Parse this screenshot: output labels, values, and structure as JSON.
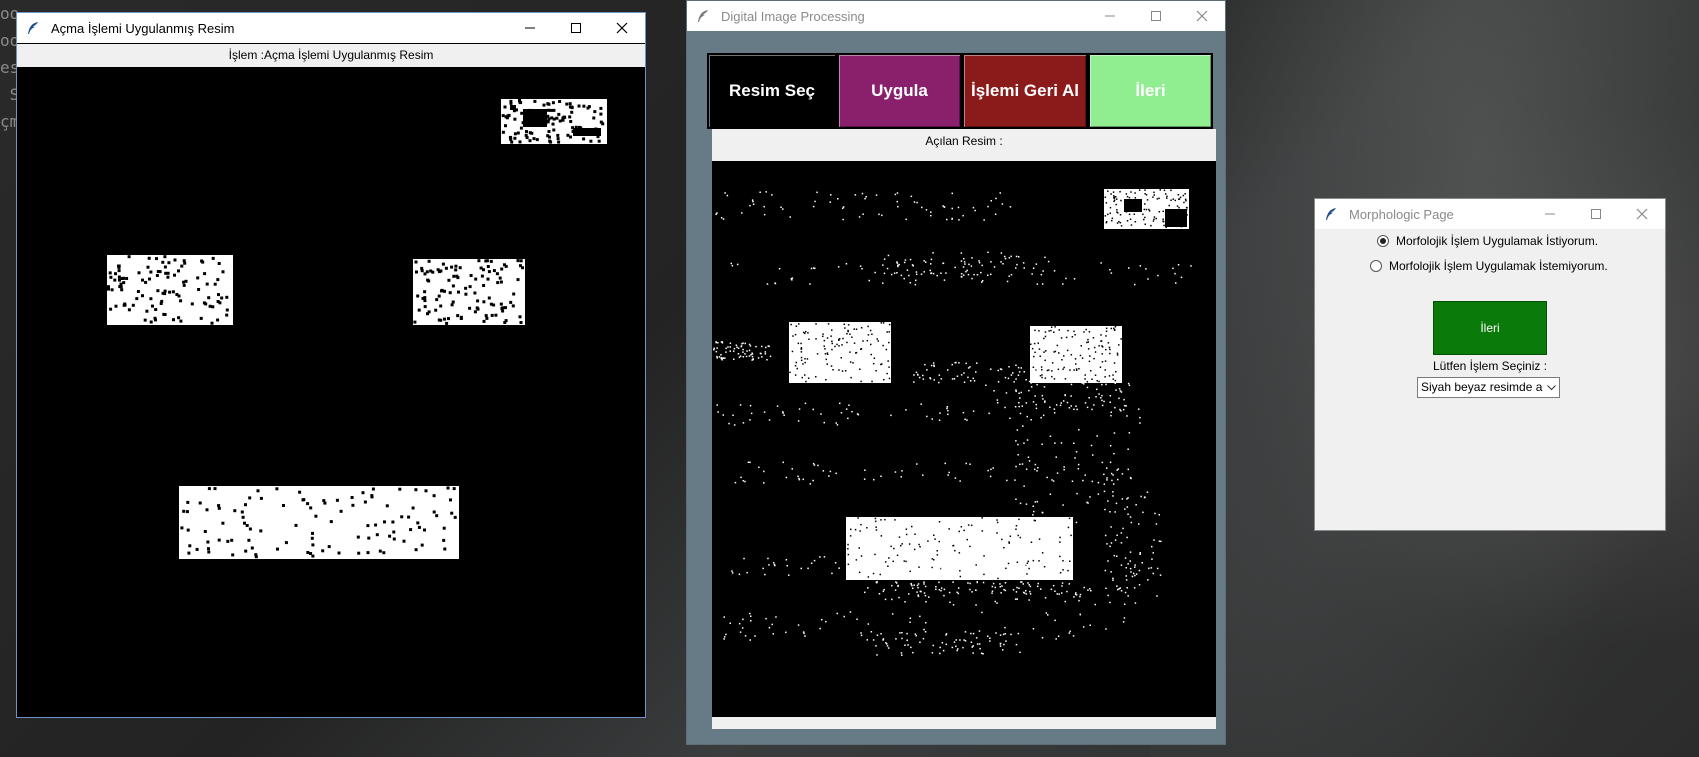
{
  "desktop": {
    "code_lines": [
      "oo :. Resim Yüklendi.",
      "oo",
      "es",
      " S",
      "çm"
    ]
  },
  "window_opened": {
    "title": "Açma İşlemi Uygulanmış Resim",
    "header_label": "İşlem :Açma İşlemi Uygulanmış Resim",
    "controls": [
      "minimize-icon",
      "maximize-icon",
      "close-icon"
    ]
  },
  "window_main": {
    "title": "Digital Image Processing",
    "buttons": [
      {
        "label": "Resim Seç",
        "color": "#000000"
      },
      {
        "label": "Uygula",
        "color": "#8a1f6c"
      },
      {
        "label": "İşlemi Geri Al",
        "color": "#8b1a1a"
      },
      {
        "label": "İleri",
        "color": "#90ee90"
      }
    ],
    "image_label": "Açılan Resim :",
    "background_color": "#667b85"
  },
  "window_morph": {
    "title": "Morphologic Page",
    "radio_options": [
      {
        "label": "Morfolojik İşlem Uygulamak İstiyorum.",
        "selected": true
      },
      {
        "label": "Morfolojik İşlem Uygulamak İstemiyorum.",
        "selected": false
      }
    ],
    "next_button": "İleri",
    "next_button_color": "#0a7a0a",
    "select_label": "Lütfen İşlem Seçiniz :",
    "select_value": "Siyah beyaz resimde aç"
  }
}
